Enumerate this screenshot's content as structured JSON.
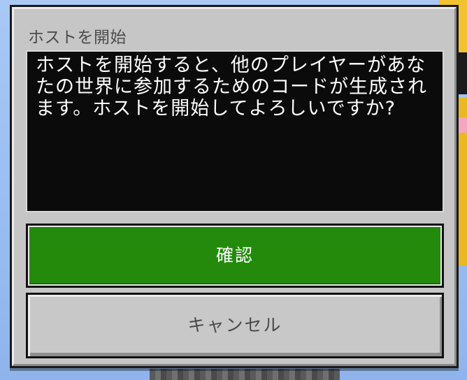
{
  "dialog": {
    "title": "ホストを開始",
    "message": "ホストを開始すると、他のプレイヤーがあなたの世界に参加するためのコードが生成されます。ホストを開始してよろしいですか?",
    "confirm_label": "確認",
    "cancel_label": "キャンセル"
  },
  "colors": {
    "confirm_button": "#238a0b",
    "cancel_button": "#c8c8c8",
    "dialog_background": "#c6c6c6",
    "message_background": "#0b0b0b"
  }
}
